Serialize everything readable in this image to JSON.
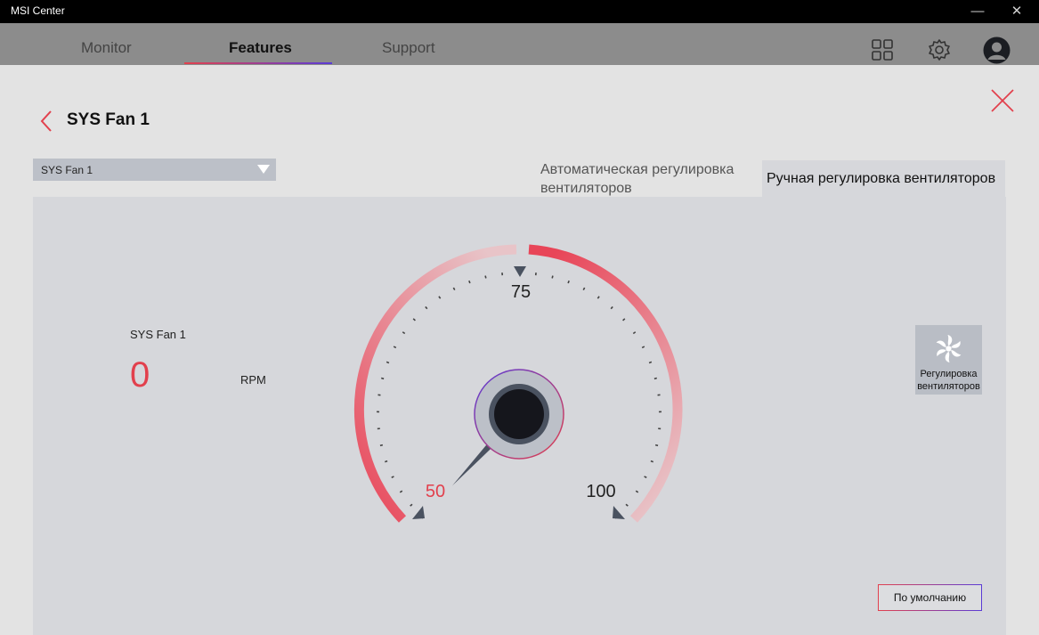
{
  "window": {
    "title": "MSI Center",
    "minimize": "—",
    "close": "✕"
  },
  "nav": {
    "tabs": [
      {
        "label": "Monitor"
      },
      {
        "label": "Features"
      },
      {
        "label": "Support"
      }
    ],
    "icons": [
      "grid-icon",
      "gear-icon",
      "avatar"
    ]
  },
  "page": {
    "title": "SYS Fan 1"
  },
  "fan_select": {
    "value": "SYS Fan 1"
  },
  "mode_tabs": {
    "auto": "Автоматическая регулировка вентиляторов",
    "manual": "Ручная регулировка вентиляторов"
  },
  "fan_status": {
    "name": "SYS Fan 1",
    "rpm": "0",
    "unit": "RPM"
  },
  "gauge": {
    "min_label": "50",
    "mid_label": "75",
    "max_label": "100",
    "value": 50
  },
  "fan_control": {
    "label": "Регулировка вентиляторов"
  },
  "default_button": {
    "label": "По умолчанию"
  },
  "colors": {
    "accent": "#e2404d",
    "accent2": "#5a3bd6"
  }
}
